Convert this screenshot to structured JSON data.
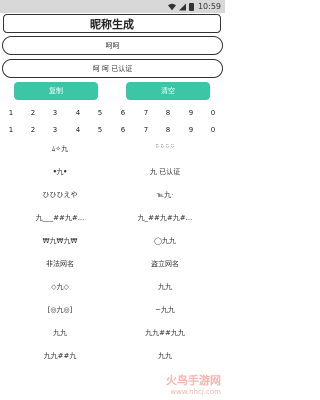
{
  "status_bar": {
    "time": "10:59"
  },
  "title": "昵称生成",
  "input": {
    "value": "呵呵"
  },
  "output": {
    "value": "呵 呵   已认证"
  },
  "buttons": {
    "copy": "复制",
    "clear": "清空"
  },
  "number_rows": [
    [
      "1",
      "2",
      "3",
      "4",
      "5",
      "6",
      "7",
      "8",
      "9",
      "0"
    ],
    [
      "1",
      "2",
      "3",
      "4",
      "5",
      "6",
      "7",
      "8",
      "9",
      "0"
    ]
  ],
  "nickname_results": [
    [
      "ﾑ✧九",
      "ᵕ̈ ᵕ̈ ᵕ̈ ᵕ̈"
    ],
    [
      "ꔷ九ꔷ",
      "九  已认证"
    ],
    [
      "ひひひえや",
      "℡九·"
    ],
    [
      "九___##九#...",
      "九_##九#九#..."
    ],
    [
      "₩九₩九₩",
      "◯九九"
    ],
    [
      "非法网名",
      "盗立网名"
    ],
    [
      "◇九◇",
      "九九"
    ],
    [
      "[◎九◎]",
      "~九九"
    ],
    [
      "九九",
      "九九##九九"
    ],
    [
      "九九##九",
      "九九"
    ]
  ],
  "watermark": {
    "main": "火鸟手游网",
    "sub": "www.hhcj.com"
  }
}
